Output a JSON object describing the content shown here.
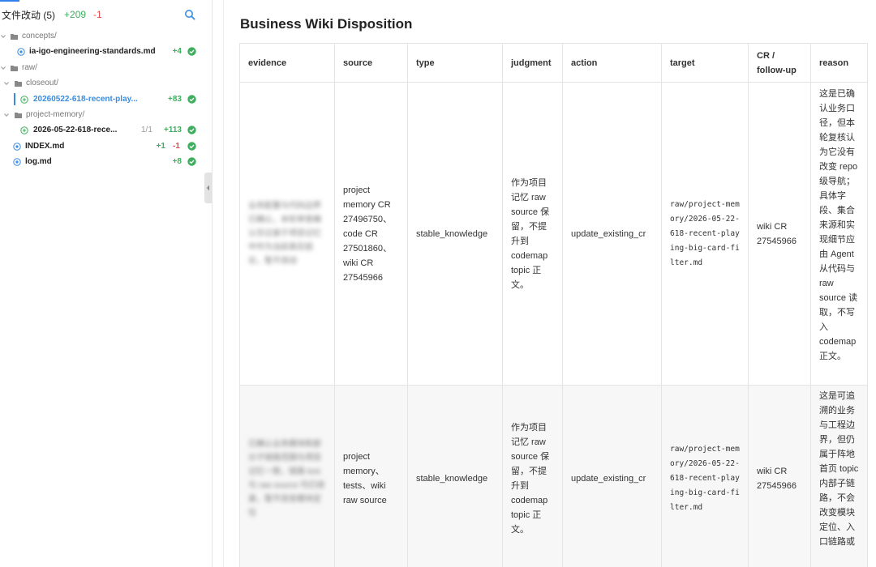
{
  "sidebar": {
    "title": "文件改动 (5)",
    "total_added": "+209",
    "total_removed": "-1",
    "search_icon": "search-icon",
    "tree": [
      {
        "type": "folder",
        "label": "concepts/",
        "depth": 0
      },
      {
        "type": "file",
        "label": "ia-igo-engineering-standards.md",
        "depth": 1,
        "added": "+4",
        "removed": "",
        "count": "",
        "status": "check"
      },
      {
        "type": "folder",
        "label": "raw/",
        "depth": 0
      },
      {
        "type": "folder",
        "label": "closeout/",
        "depth": 1
      },
      {
        "type": "file",
        "label": "20260522-618-recent-play...",
        "depth": 2,
        "added": "+83",
        "removed": "",
        "count": "",
        "status": "check",
        "active": true
      },
      {
        "type": "folder",
        "label": "project-memory/",
        "depth": 1
      },
      {
        "type": "file",
        "label": "2026-05-22-618-rece...",
        "depth": 2,
        "added": "+113",
        "removed": "",
        "count": "1/1",
        "status": "check"
      },
      {
        "type": "file",
        "label": "INDEX.md",
        "depth": 1,
        "added": "+1",
        "removed": "-1",
        "count": "",
        "status": "check"
      },
      {
        "type": "file",
        "label": "log.md",
        "depth": 1,
        "added": "+8",
        "removed": "",
        "count": "",
        "status": "check"
      }
    ]
  },
  "main": {
    "title": "Business Wiki Disposition",
    "columns": [
      "evidence",
      "source",
      "type",
      "judgment",
      "action",
      "target",
      "CR / follow-up",
      "reason"
    ],
    "rows": [
      {
        "evidence": "业务配置与代码边界已确认，本轮审查确认仅记录于项目记忆中作为当前真实结论，暂不改动",
        "source": "project memory CR 27496750、code CR 27501860、wiki CR 27545966",
        "type": "stable_knowledge",
        "judgment": "作为项目记忆 raw source 保留，不提升到 codemap topic 正文。",
        "action": "update_existing_cr",
        "target": "raw/project-memory/2026-05-22-618-recent-playing-big-card-filter.md",
        "cr": "wiki CR 27545966",
        "reason": "这是已确认业务口径，但本轮复核认为它没有改变 repo 级导航；具体字段、集合来源和实现细节应由 Agent 从代码与 raw source 读取，不写入 codemap 正文。"
      },
      {
        "evidence": "已确认业务模块和部分子链路范围与项目记忆一致，链路 test 与 raw source 均已收录，暂不改变模块定位",
        "source": "project memory、tests、wiki raw source",
        "type": "stable_knowledge",
        "judgment": "作为项目记忆 raw source 保留，不提升到 codemap topic 正文。",
        "action": "update_existing_cr",
        "target": "raw/project-memory/2026-05-22-618-recent-playing-big-card-filter.md",
        "cr": "wiki CR 27545966",
        "reason": "这是可追溯的业务与工程边界，但仍属于阵地首页 topic 内部子链路，不会改变模块定位、入口链路或"
      }
    ]
  }
}
